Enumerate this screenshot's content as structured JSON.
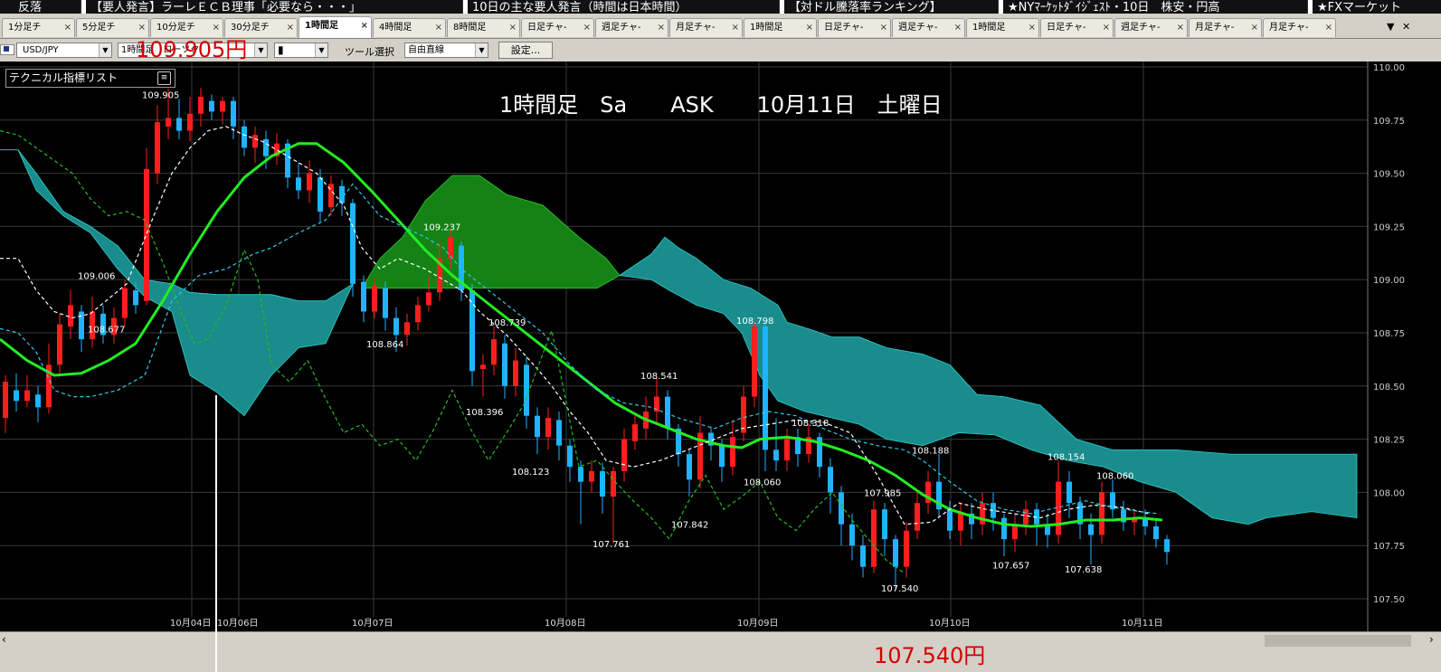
{
  "news": [
    "反落",
    "【要人発言】ラーレＥＣＢ理事「必要なら・・・」",
    "10日の主な要人発言（時間は日本時間）",
    "【対ドル騰落率ランキング】",
    "★NYﾏｰｹｯﾄﾀﾞｲｼﾞｪｽﾄ・10日　株安・円高",
    "★FXマーケット"
  ],
  "tabs": [
    "1分足チ",
    "5分足チ",
    "10分足チ",
    "30分足チ",
    "1時間足",
    "4時間足",
    "8時間足",
    "日足チャ-",
    "週足チャ-",
    "月足チャ-",
    "1時間足",
    "日足チャ-",
    "週足チャ-",
    "1時間足",
    "日足チャ-",
    "週足チャ-",
    "月足チャ-",
    "月足チャ-"
  ],
  "active_tab": 4,
  "tab_close": "×",
  "toolbar": {
    "symbol": "USD/JPY",
    "timeframe": "1時間足",
    "candle_type": "ローソク",
    "tool_label": "ツール選択",
    "tool_value": "自由直線",
    "settings_button": "設定..."
  },
  "indicator_list_label": "テクニカル指標リスト",
  "chart_title": "1時間足　Sa　　ASK　　10月11日　土曜日",
  "overlay_high_text": "109.905円",
  "overlay_low_text": "107.540円",
  "colors": {
    "up_candle": "#ff1e1e",
    "down_candle": "#1eb4ff",
    "cloud_bear": "#1a8c8c",
    "cloud_bull": "#148214",
    "ma_line": "#22ee22",
    "grid": "#3a3a3a"
  },
  "chart_data": {
    "type": "candlestick",
    "y_axis": {
      "min": 107.5,
      "max": 110.0,
      "ticks": [
        "110.00",
        "109.75",
        "109.50",
        "109.25",
        "109.00",
        "108.75",
        "108.50",
        "108.25",
        "108.00",
        "107.75",
        "107.50"
      ]
    },
    "x_labels": [
      "10月04日",
      "10月06日",
      "10月07日",
      "10月08日",
      "10月09日",
      "10月10日",
      "10月11日"
    ],
    "price_labels": [
      "109.905",
      "109.006",
      "108.677",
      "109.237",
      "108.864",
      "108.739",
      "108.396",
      "108.123",
      "108.541",
      "107.761",
      "107.842",
      "108.798",
      "108.060",
      "108.318",
      "107.985",
      "107.540",
      "108.188",
      "107.657",
      "108.154",
      "107.638",
      "108.060"
    ],
    "overlays": [
      "ichimoku-cloud",
      "tenkan-sen",
      "kijun-sen",
      "chikou-span",
      "moving-average"
    ]
  }
}
